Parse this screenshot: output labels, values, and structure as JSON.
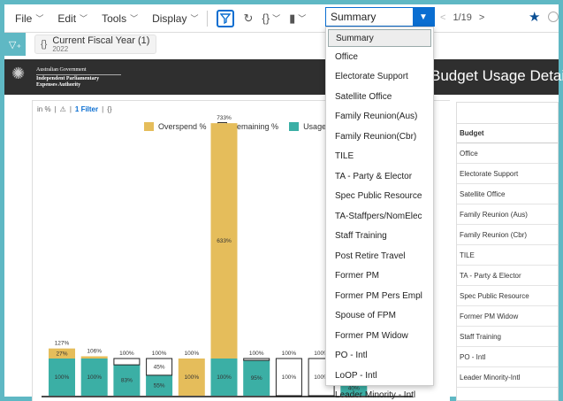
{
  "toolbar": {
    "menus": [
      "File",
      "Edit",
      "Tools",
      "Display"
    ],
    "selected_page": "Summary",
    "pager": "1/19"
  },
  "filterbar": {
    "filter_title": "Current Fiscal Year (1)",
    "filter_value": "2022"
  },
  "banner": {
    "gov_line1": "Australian Government",
    "gov_line2": "Independent Parliamentary",
    "gov_line3": "Expenses Authority",
    "title": "Budget Usage Details"
  },
  "chart_header": {
    "unit": "in %",
    "filter": "1 Filter"
  },
  "chart_data": {
    "type": "bar",
    "series": [
      {
        "name": "Overspend %",
        "color": "#e5bd5b"
      },
      {
        "name": "Remaining %",
        "color": "#ffffff"
      },
      {
        "name": "Usage %",
        "color": "#3bafa5"
      }
    ],
    "bars": [
      {
        "usage": 100,
        "overspend": 27,
        "total_label": "127%",
        "usage_label": "100%",
        "overspend_label": "27%",
        "remaining": 0
      },
      {
        "usage": 100,
        "overspend": 6,
        "total_label": "106%",
        "usage_label": "100%",
        "overspend_label": "",
        "remaining": 0
      },
      {
        "usage": 83,
        "overspend": 0,
        "total_label": "100%",
        "usage_label": "83%",
        "overspend_label": "",
        "remaining": 17
      },
      {
        "usage": 55,
        "overspend": 0,
        "total_label": "100%",
        "usage_label": "55%",
        "overspend_label": "45%",
        "remaining": 45
      },
      {
        "usage": 0,
        "overspend": 100,
        "total_label": "100%",
        "usage_label": "100%",
        "overspend_label": "",
        "remaining": 0
      },
      {
        "usage": 100,
        "overspend": 633,
        "total_label": "733%",
        "usage_label": "100%",
        "overspend_label": "633%",
        "remaining": 0
      },
      {
        "usage": 95,
        "overspend": 0,
        "total_label": "100%",
        "usage_label": "95%",
        "overspend_label": "",
        "remaining": 5
      },
      {
        "usage": 0,
        "overspend": 0,
        "total_label": "100%",
        "usage_label": "100%",
        "overspend_label": "",
        "remaining": 100
      },
      {
        "usage": 0,
        "overspend": 0,
        "total_label": "100%",
        "usage_label": "100%",
        "overspend_label": "",
        "remaining": 100
      },
      {
        "usage": 40,
        "overspend": 0,
        "total_label": "",
        "usage_label": "40%",
        "overspend_label": "",
        "remaining": 0
      }
    ]
  },
  "dropdown": {
    "items": [
      "Summary",
      "Office",
      "Electorate Support",
      "Satellite Office",
      "Family Reunion(Aus)",
      "Family Reunion(Cbr)",
      "TILE",
      "TA - Party & Elector",
      "Spec Public Resource",
      "TA-Staffpers/NomElec",
      "Staff Training",
      "Post Retire Travel",
      "Former PM",
      "Former PM Pers Empl",
      "Spouse of FPM",
      "Former PM Widow",
      "PO - Intl",
      "LoOP - Intl",
      "Leader Minority - Intl"
    ]
  },
  "table": {
    "header": "Budget",
    "rows": [
      "Office",
      "Electorate Support",
      "Satellite Office",
      "Family Reunion (Aus)",
      "Family Reunion (Cbr)",
      "TILE",
      "TA - Party & Elector",
      "Spec Public Resource",
      "Former PM Widow",
      "Staff Training",
      "PO - Intl",
      "Leader Minority-Intl"
    ]
  }
}
